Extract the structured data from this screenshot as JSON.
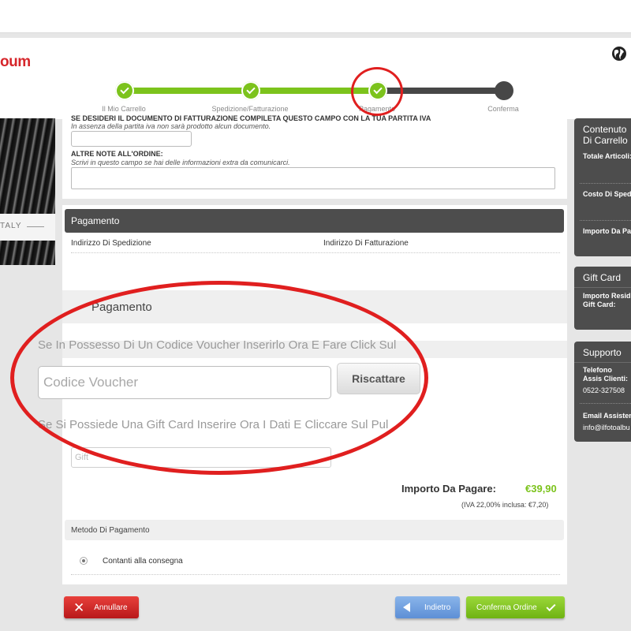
{
  "brand": {
    "logo_text": "oum"
  },
  "progress": {
    "steps": [
      {
        "label": "Il Mio Carrello",
        "done": true
      },
      {
        "label": "Spedizione/Fatturazione",
        "done": true
      },
      {
        "label": "Pagamento",
        "done": true
      },
      {
        "label": "Conferma",
        "done": false
      }
    ]
  },
  "left_image": {
    "caption": "TALY"
  },
  "order_form": {
    "cut_heading": "SE DESIDERI IL DOCUMENTO DI FATTURAZIONE COMPILETA QUESTO CAMPO CON LA TUA PARTITA IVA",
    "piva_note": "In assenza della partita iva non sarà prodotto alcun documento.",
    "notes_label": "ALTRE NOTE ALL'ORDINE:",
    "notes_hint": "Scrivi in questo campo se hai delle informazioni extra da comunicarci."
  },
  "payment": {
    "bar_title": "Pagamento",
    "shipping_label": "Indirizzo Di Spedizione",
    "billing_label": "Indirizzo Di Fatturazione",
    "section_title": "Pagamento",
    "voucher_prompt": "Se In Possesso Di Un Codice Voucher Inserirlo Ora E Fare Click Sul",
    "voucher_placeholder": "Codice Voucher",
    "redeem_label": "Riscattare",
    "gift_prompt": "Se Si Possiede Una Gift Card Inserire Ora I Dati E Cliccare Sul Pul",
    "gift_placeholder": "Gift",
    "amount_label": "Importo Da Pagare:",
    "amount_value": "€39,90",
    "vat_note": "(IVA 22,00% inclusa: €7,20)",
    "method_title": "Metodo Di Pagamento",
    "method_option": "Contanti alla consegna"
  },
  "actions": {
    "cancel": "Annullare",
    "back": "Indietro",
    "confirm": "Conferma Ordine"
  },
  "sidebar": {
    "cart_title": "Contenuto Di Carrello",
    "cart_items": [
      "Totale Articoli:",
      "Costo Di Sped",
      "Importo Da Pa"
    ],
    "gift_title": "Gift Card",
    "gift_residual": "Importo Resid Gift Card:",
    "support_title": "Supporto",
    "support_phone_label": "Telefono Assis Clienti:",
    "support_phone": "0522-327508",
    "support_email_label": "Email Assisten",
    "support_email": "info@ilfotoalbu"
  },
  "colors": {
    "accent_green": "#7cc31c",
    "danger_red": "#d6262b",
    "dark_bar": "#4d4d4d"
  }
}
